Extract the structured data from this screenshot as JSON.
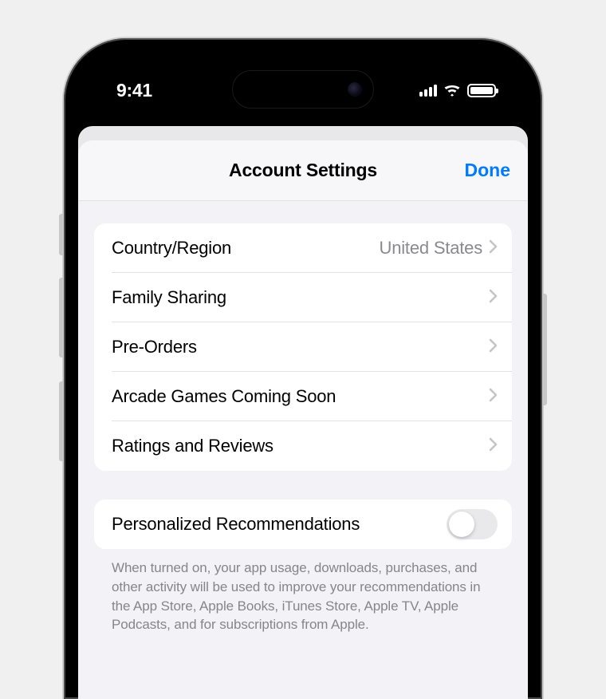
{
  "status": {
    "time": "9:41"
  },
  "nav": {
    "title": "Account Settings",
    "done": "Done"
  },
  "group1": {
    "country_label": "Country/Region",
    "country_value": "United States",
    "family_sharing": "Family Sharing",
    "pre_orders": "Pre-Orders",
    "arcade": "Arcade Games Coming Soon",
    "ratings": "Ratings and Reviews"
  },
  "group2": {
    "personalized_label": "Personalized Recommendations",
    "personalized_on": false
  },
  "footer": "When turned on, your app usage, downloads, purchases, and other activity will be used to improve your recommendations in the App Store, Apple Books, iTunes Store, Apple TV, Apple Podcasts, and for subscriptions from Apple."
}
